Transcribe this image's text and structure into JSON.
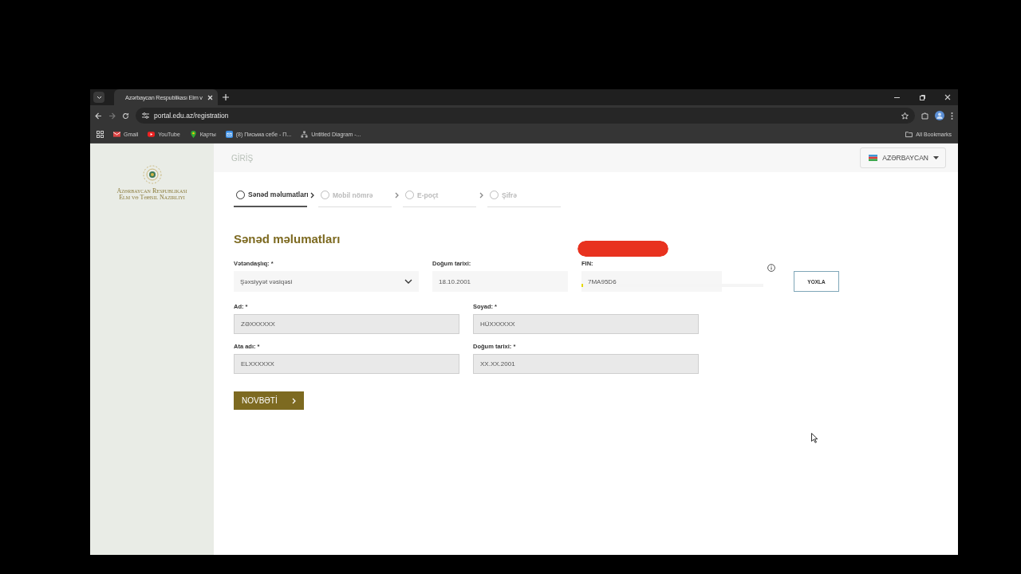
{
  "browser": {
    "tab_title": "Azərbaycan Respublikası Elm v",
    "url": "portal.edu.az/registration",
    "bookmarks": [
      {
        "label": "Gmail",
        "kind": "mail"
      },
      {
        "label": "YouTube",
        "kind": "video"
      },
      {
        "label": "Карты",
        "kind": "map"
      },
      {
        "label": "(8) Письма себе - П...",
        "kind": "message"
      },
      {
        "label": "Untitled Diagram -...",
        "kind": "diagram"
      }
    ],
    "all_bookmarks": "All Bookmarks"
  },
  "sidebar": {
    "logo_lines": [
      "Azərbaycan Respublikası",
      "Elm və Təhsil Nazirliyi"
    ]
  },
  "header": {
    "login": "GİRİŞ",
    "language": "AZƏRBAYCAN"
  },
  "steps": [
    {
      "label": "Sənəd məlumatları",
      "selected": true
    },
    {
      "label": "Mobil nömrə",
      "selected": false
    },
    {
      "label": "E-poçt",
      "selected": false
    },
    {
      "label": "Şifrə",
      "selected": false
    }
  ],
  "form": {
    "title": "Sənəd məlumatları",
    "top_fields": [
      {
        "kind": "select",
        "label": "Vətəndaşlıq: *",
        "value": "Şəxsiyyət vəsiqəsi"
      },
      {
        "kind": "input",
        "label": "Doğum tarixi:",
        "value": "18.10.2001"
      },
      {
        "kind": "fin",
        "label": "FIN:",
        "value": "7MA95D6",
        "level": 0.01
      }
    ],
    "check_button": "YOXLA",
    "fields": [
      {
        "label": "Ad: *",
        "value": "ZƏXXXXXX"
      },
      {
        "label": "Soyad: *",
        "value": "HÜXXXXXX"
      },
      {
        "label": "Ata adı: *",
        "value": "ELXXXXXX"
      },
      {
        "label": "Doğum tarixi: *",
        "value": "XX.XX.2001"
      }
    ],
    "next_button": "NOVBƏTİ"
  }
}
